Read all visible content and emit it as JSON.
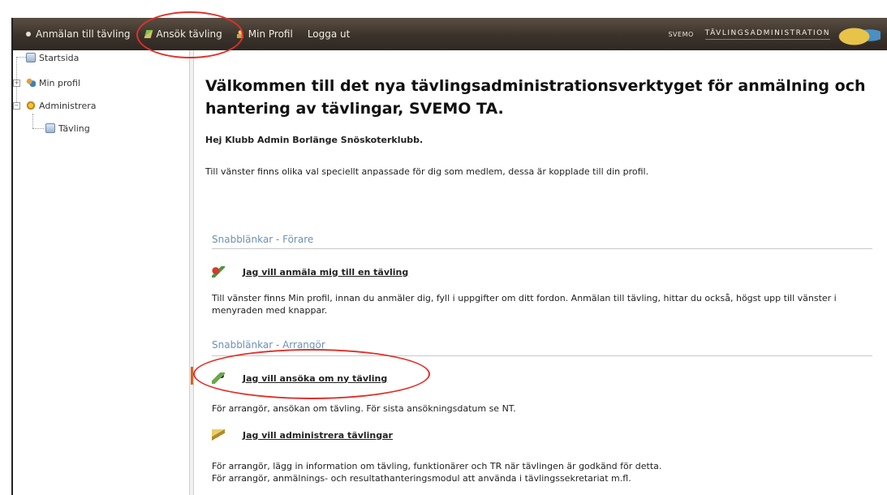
{
  "nav": {
    "items": [
      {
        "label": "Anmälan till tävling",
        "icon": "dot-icon"
      },
      {
        "label": "Ansök tävling",
        "icon": "pen-icon"
      },
      {
        "label": "Min Profil",
        "icon": "person-icon"
      },
      {
        "label": "Logga ut",
        "icon": ""
      }
    ],
    "brand_small": "SVEMO",
    "brand_title": "TÄVLINGSADMINISTRATION"
  },
  "sidebar": {
    "items": [
      {
        "label": "Startsida",
        "icon": "page-icon"
      },
      {
        "label": "Min profil",
        "icon": "people-icon"
      },
      {
        "label": "Administrera",
        "icon": "gear-icon"
      },
      {
        "label": "Tävling",
        "icon": "page-icon"
      }
    ]
  },
  "main": {
    "title": "Välkommen till det nya tävlingsadministrationsverktyget för anmälning och hantering av tävlingar, SVEMO TA.",
    "greeting": "Hej Klubb Admin Borlänge Snöskoterklubb.",
    "intro": "Till vänster finns olika val speciellt anpassade för dig som medlem, dessa är kopplade till din profil.",
    "sections": [
      {
        "title": "Snabblänkar - Förare",
        "links": [
          {
            "label": "Jag vill anmäla mig till en tävling",
            "desc": "Till vänster finns Min profil, innan du anmäler dig, fyll i uppgifter om ditt fordon. Anmälan till tävling, hittar du också, högst upp till vänster i menyraden med knappar."
          }
        ]
      },
      {
        "title": "Snabblänkar - Arrangör",
        "links": [
          {
            "label": "Jag vill ansöka om ny tävling",
            "desc": "För arrangör, ansökan om tävling. För sista ansökningsdatum se NT."
          },
          {
            "label": "Jag vill administrera tävlingar",
            "desc": "För arrangör, lägg in information om tävling, funktionärer och TR när tävlingen är godkänd för detta.",
            "desc2": "För arrangör, anmälnings- och resultathanteringsmodul att använda i tävlingssekretariat m.fl."
          }
        ]
      }
    ]
  },
  "colors": {
    "annotation": "#e0312a",
    "section_title": "#6d8fb8",
    "topbar": "#3b332b"
  }
}
